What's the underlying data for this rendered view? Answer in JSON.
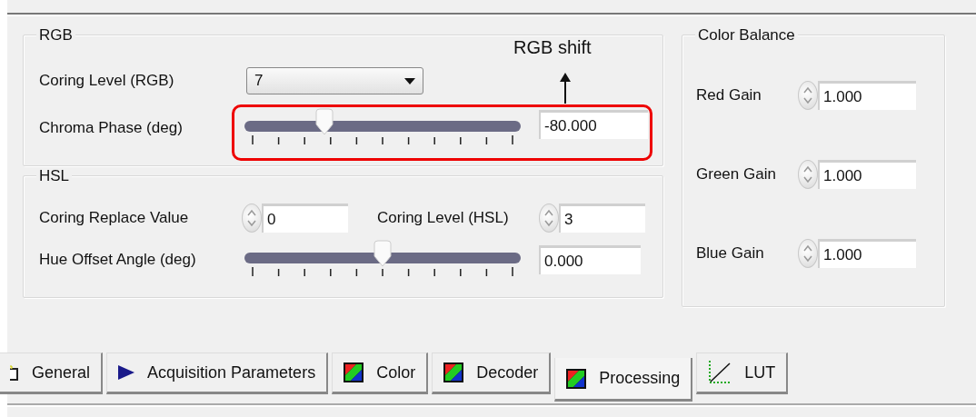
{
  "rgb_group": {
    "title": "RGB",
    "coring_level": {
      "label": "Coring Level (RGB)",
      "value": "7"
    },
    "chroma_phase": {
      "label": "Chroma Phase (deg)",
      "level": 0.29,
      "value": "-80.000"
    }
  },
  "annotation": {
    "label": "RGB shift"
  },
  "hsl_group": {
    "title": "HSL",
    "coring_replace": {
      "label": "Coring Replace Value",
      "value": "0"
    },
    "coring_level": {
      "label": "Coring Level (HSL)",
      "value": "3"
    },
    "hue_offset": {
      "label": "Hue Offset Angle (deg)",
      "level": 0.5,
      "value": "0.000"
    }
  },
  "color_balance": {
    "title": "Color Balance",
    "gains": [
      {
        "label": "Red Gain",
        "value": "1.000"
      },
      {
        "label": "Green Gain",
        "value": "1.000"
      },
      {
        "label": "Blue Gain",
        "value": "1.000"
      }
    ]
  },
  "tabs": [
    {
      "label": "General",
      "kind": "general",
      "selected": false
    },
    {
      "label": "Acquisition Parameters",
      "kind": "play",
      "selected": false
    },
    {
      "label": "Color",
      "kind": "color",
      "selected": false
    },
    {
      "label": "Decoder",
      "kind": "color",
      "selected": false
    },
    {
      "label": "Processing",
      "kind": "color",
      "selected": true
    },
    {
      "label": "LUT",
      "kind": "lut",
      "selected": false
    }
  ]
}
